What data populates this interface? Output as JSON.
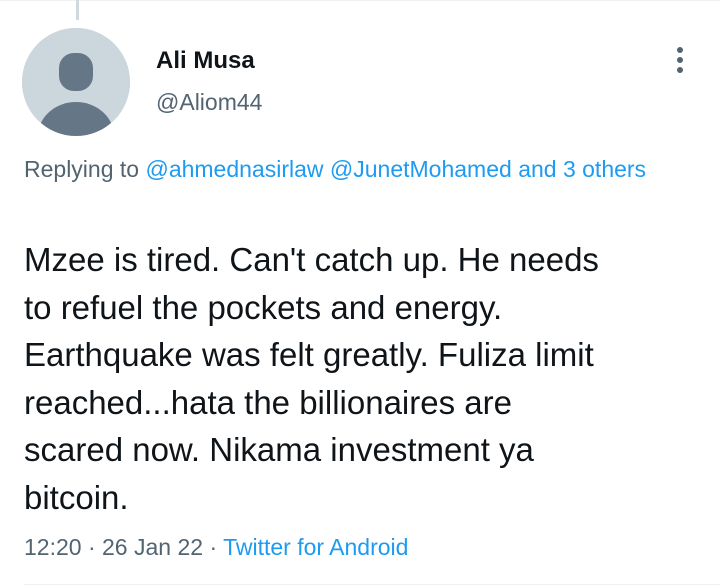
{
  "tweet": {
    "author": {
      "name": "Ali Musa",
      "handle": "@Aliom44"
    },
    "replying_to": {
      "prefix": "Replying to",
      "mention_1": "@ahmednasirlaw",
      "mention_2": "@JunetMohamed",
      "joiner": "and",
      "others": "3 others"
    },
    "text": "Mzee is tired. Can't catch up. He needs\nto refuel the pockets and energy.\nEarthquake was felt greatly. Fuliza limit\nreached...hata  the billionaires are\nscared now. Nikama investment ya\nbitcoin.",
    "time": "12:20",
    "date": "26 Jan 22",
    "separator": "·",
    "source": "Twitter for Android"
  },
  "icons": {
    "avatar": "default-avatar-icon",
    "more": "more-options-icon"
  },
  "colors": {
    "link": "#1d9bf0",
    "secondary_text": "#536471",
    "primary_text": "#0f1419",
    "avatar_bg": "#ccd6dd",
    "avatar_figure": "#657786"
  }
}
